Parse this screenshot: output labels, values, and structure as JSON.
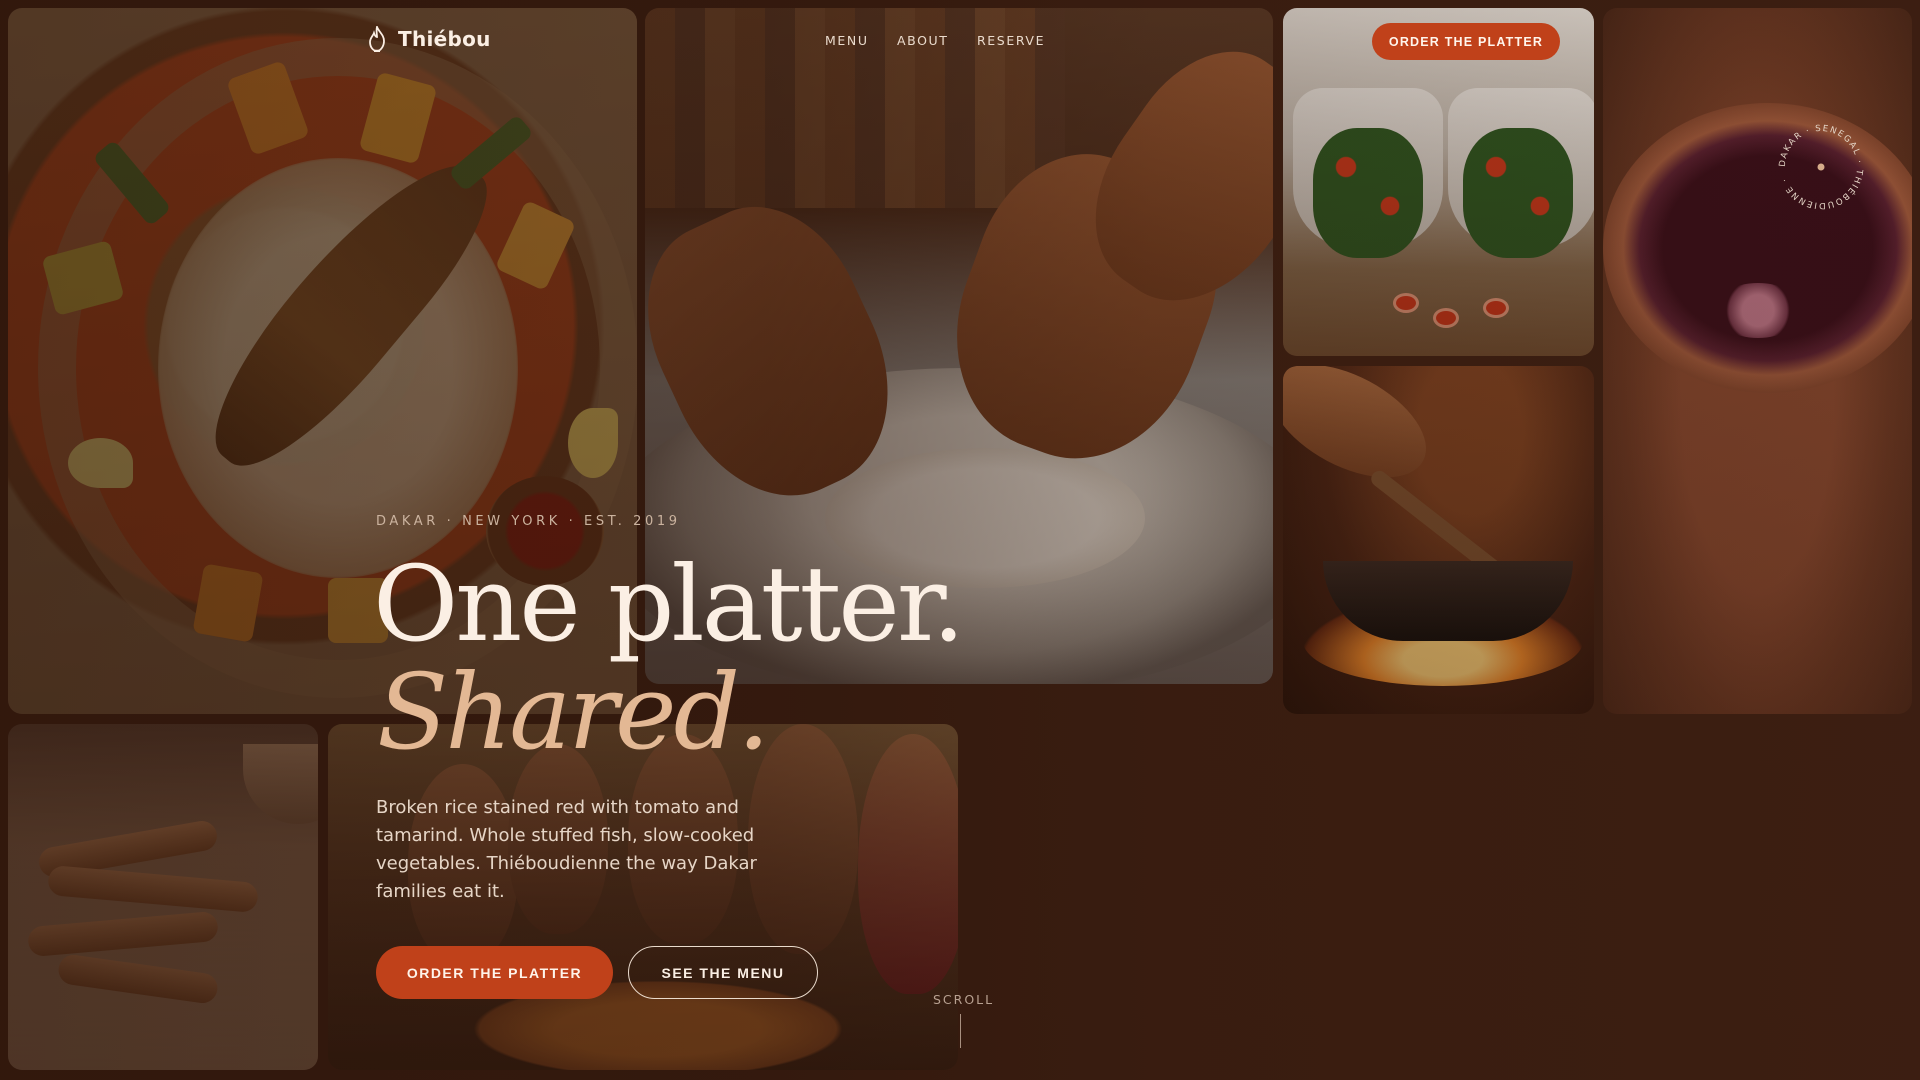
{
  "brand": {
    "name": "Thiébou",
    "icon": "flame-icon"
  },
  "nav": {
    "links": [
      "MENU",
      "ABOUT",
      "RESERVE"
    ],
    "cta": "ORDER THE PLATTER"
  },
  "hero": {
    "eyebrow": "DAKAR · NEW YORK · EST. 2019",
    "headline": "One platter.",
    "headline_accent": "Shared.",
    "body": "Broken rice stained red with tomato and tamarind. Whole stuffed fish, slow-cooked vegetables. Thiéboudienne the way Dakar families eat it.",
    "primary_cta": "ORDER THE PLATTER",
    "secondary_cta": "SEE THE MENU"
  },
  "badge": {
    "text": "DAKAR · SENEGAL · THIÉBOUDIENNE · "
  },
  "scroll": {
    "label": "SCROLL"
  },
  "colors": {
    "accent": "#c0411a",
    "background": "#3d1f12",
    "headline_accent": "#e3b894"
  }
}
